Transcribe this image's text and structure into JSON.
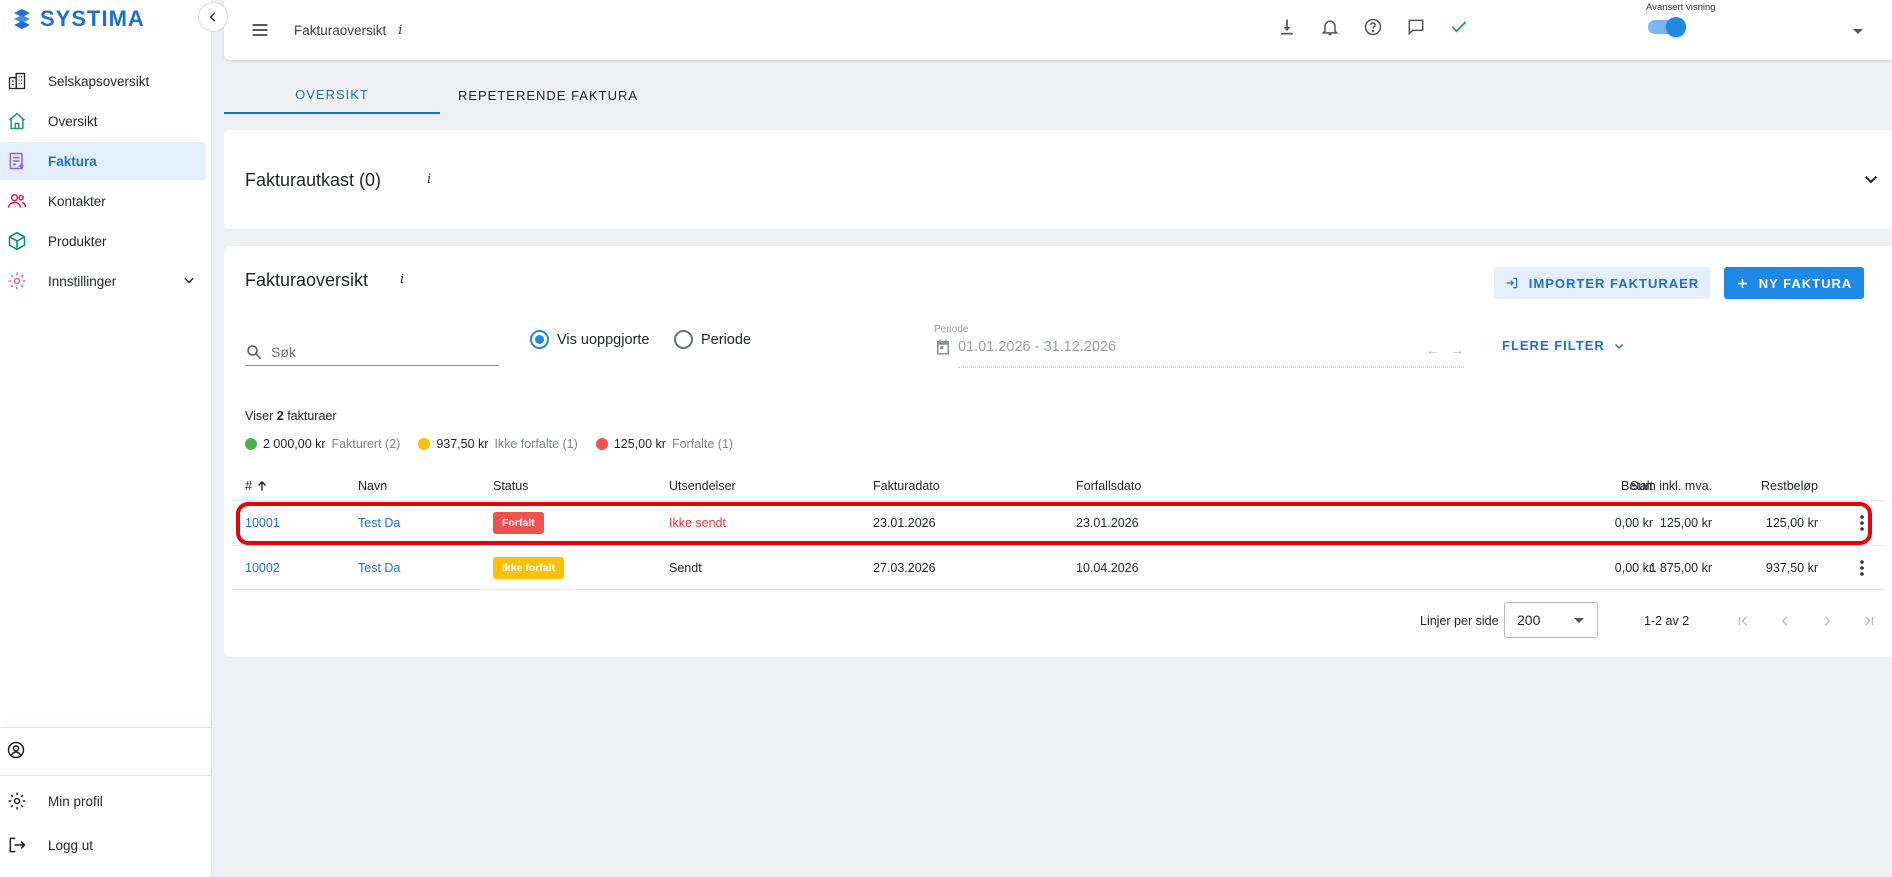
{
  "app": {
    "logo_text": "SYSTIMA"
  },
  "sidebar": {
    "items": [
      {
        "label": "Selskapsoversikt",
        "icon": "building-icon"
      },
      {
        "label": "Oversikt",
        "icon": "home-icon"
      },
      {
        "label": "Faktura",
        "icon": "invoice-icon",
        "active": true
      },
      {
        "label": "Kontakter",
        "icon": "contacts-icon"
      },
      {
        "label": "Produkter",
        "icon": "box-icon"
      },
      {
        "label": "Innstillinger",
        "icon": "gear-icon"
      }
    ],
    "bottom": [
      {
        "label": "Min profil",
        "icon": "gear-icon"
      },
      {
        "label": "Logg ut",
        "icon": "logout-icon"
      }
    ]
  },
  "topbar": {
    "title": "Fakturaoversikt",
    "info": "i",
    "advanced_label": "Avansert visning",
    "advanced_on": true
  },
  "tabs": [
    {
      "label": "OVERSIKT",
      "active": true
    },
    {
      "label": "REPETERENDE FAKTURA",
      "active": false
    }
  ],
  "drafts": {
    "title": "Fakturautkast (0)",
    "info": "i"
  },
  "overview": {
    "title": "Fakturaoversikt",
    "info": "i",
    "import_label": "IMPORTER FAKTURAER",
    "new_label": "NY FAKTURA",
    "search_placeholder": "Søk",
    "radio_unsettled": "Vis uoppgjorte",
    "radio_period": "Periode",
    "period_label": "Periode",
    "period_value": "01.01.2026 - 31.12.2026",
    "more_filters": "FLERE FILTER",
    "showing_prefix": "Viser",
    "showing_count": "2",
    "showing_suffix": "fakturaer",
    "summary": [
      {
        "amount": "2 000,00 kr",
        "label": "Fakturert (2)",
        "color": "#4caf50"
      },
      {
        "amount": "937,50 kr",
        "label": "Ikke forfalte (1)",
        "color": "#ffc107"
      },
      {
        "amount": "125,00 kr",
        "label": "Forfalte (1)",
        "color": "#ef5350"
      }
    ]
  },
  "table": {
    "headers": {
      "num": "#",
      "name": "Navn",
      "status": "Status",
      "uts": "Utsendelser",
      "fdato": "Fakturadato",
      "forf": "Forfallsdato",
      "sum": "Sum inkl. mva.",
      "bet": "Betalt",
      "rest": "Restbeløp"
    },
    "rows": [
      {
        "num": "10001",
        "name": "Test Da",
        "status": "Forfalt",
        "uts": "Ikke sendt",
        "fdato": "23.01.2026",
        "forf": "23.01.2026",
        "sum": "125,00 kr",
        "bet": "0,00 kr",
        "rest": "125,00 kr"
      },
      {
        "num": "10002",
        "name": "Test Da",
        "status": "Ikke forfalt",
        "uts": "Sendt",
        "fdato": "27.03.2026",
        "forf": "10.04.2026",
        "sum": "1 875,00 kr",
        "bet": "0,00 kr",
        "rest": "937,50 kr"
      }
    ]
  },
  "pagination": {
    "rows_per_page_label": "Linjer per side",
    "rows_per_page": "200",
    "range": "1-2 av 2"
  },
  "colors": {
    "accent": "#1e88e5",
    "link": "#1f6fd0",
    "highlight": "#e8000b"
  }
}
